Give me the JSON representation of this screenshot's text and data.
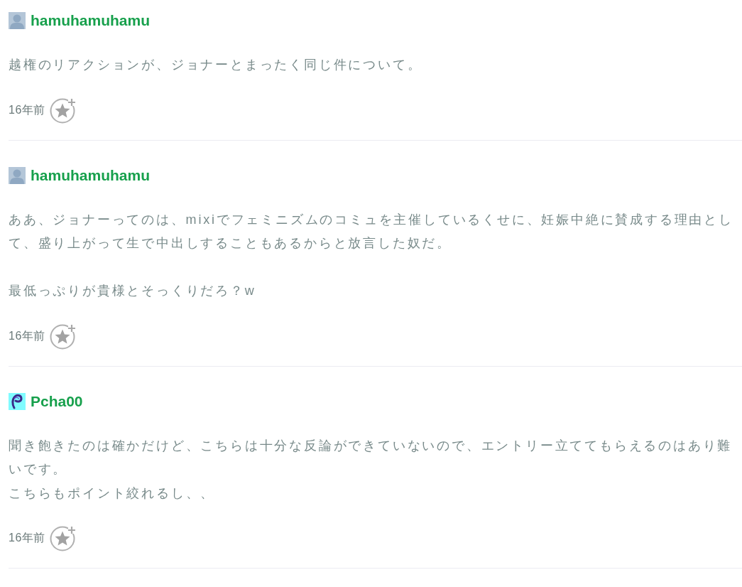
{
  "comments": [
    {
      "avatar": {
        "kind": "default"
      },
      "username": "hamuhamuhamu",
      "body": [
        [
          "越権のリアクションが、ジョナーとまったく同じ件について。"
        ]
      ],
      "time": "16年前"
    },
    {
      "avatar": {
        "kind": "default"
      },
      "username": "hamuhamuhamu",
      "body": [
        [
          "ああ、ジョナーってのは、mixiでフェミニズムのコミュを主催しているくせに、妊娠中絶に賛成する理由として、盛り上がって生で中出しすることもあるからと放言した奴だ。"
        ],
        [
          "最低っぷりが貴様とそっくりだろ？w"
        ]
      ],
      "time": "16年前"
    },
    {
      "avatar": {
        "kind": "custom"
      },
      "username": "Pcha00",
      "body": [
        [
          "聞き飽きたのは確かだけど、こちらは十分な反論ができていないので、エントリー立ててもらえるのはあり難いです。",
          "こちらもポイント絞れるし、、"
        ]
      ],
      "time": "16年前"
    }
  ]
}
